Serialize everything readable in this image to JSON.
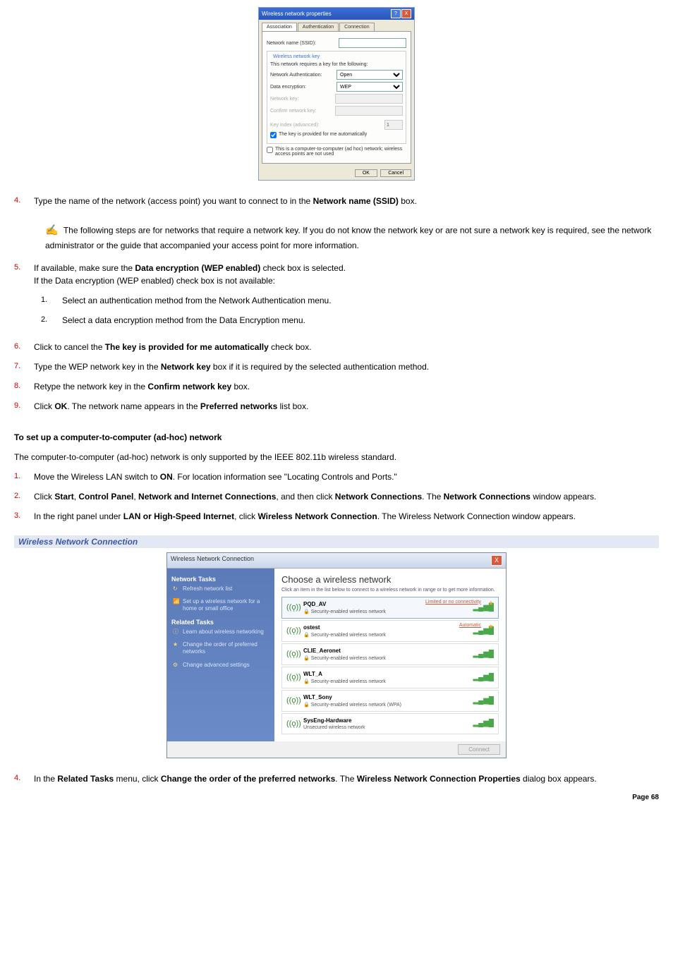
{
  "dialog1": {
    "title": "Wireless network properties",
    "tabs": [
      "Association",
      "Authentication",
      "Connection"
    ],
    "ssid_label": "Network name (SSID):",
    "fieldset_title": "Wireless network key",
    "fieldset_desc": "This network requires a key for the following:",
    "auth_label": "Network Authentication:",
    "auth_value": "Open",
    "enc_label": "Data encryption:",
    "enc_value": "WEP",
    "key_label": "Network key:",
    "confirm_label": "Confirm network key:",
    "index_label": "Key index (advanced):",
    "index_value": "1",
    "auto_key": "The key is provided for me automatically",
    "adhoc": "This is a computer-to-computer (ad hoc) network; wireless access points are not used",
    "ok": "OK",
    "cancel": "Cancel"
  },
  "steps_a": {
    "s4": {
      "n": "4.",
      "t1": "Type the name of the network (access point) you want to connect to in the ",
      "b": "Network name (SSID)",
      "t2": " box."
    },
    "note": "The following steps are for networks that require a network key. If you do not know the network key or are not sure a network key is required, see the network administrator or the guide that accompanied your access point for more information.",
    "s5": {
      "n": "5.",
      "t1": "If available, make sure the ",
      "b": "Data encryption (WEP enabled)",
      "t2": " check box is selected.",
      "t3": "If the Data encryption (WEP enabled) check box is not available:",
      "sub1": {
        "n": "1.",
        "t": "Select an authentication method from the Network Authentication menu."
      },
      "sub2": {
        "n": "2.",
        "t": "Select a data encryption method from the Data Encryption menu."
      }
    },
    "s6": {
      "n": "6.",
      "t1": "Click to cancel the ",
      "b": "The key is provided for me automatically",
      "t2": " check box."
    },
    "s7": {
      "n": "7.",
      "t1": "Type the WEP network key in the ",
      "b": "Network key",
      "t2": " box if it is required by the selected authentication method."
    },
    "s8": {
      "n": "8.",
      "t1": "Retype the network key in the ",
      "b": "Confirm network key",
      "t2": " box."
    },
    "s9": {
      "n": "9.",
      "t1": "Click ",
      "b1": "OK",
      "t2": ". The network name appears in the ",
      "b2": "Preferred networks",
      "t3": " list box."
    }
  },
  "heading2": "To set up a computer-to-computer (ad-hoc) network",
  "para2": "The computer-to-computer (ad-hoc) network is only supported by the IEEE 802.11b wireless standard.",
  "steps_b": {
    "s1": {
      "n": "1.",
      "t1": "Move the Wireless LAN switch to ",
      "b": "ON",
      "t2": ". For location information see \"Locating Controls and Ports.\""
    },
    "s2": {
      "n": "2.",
      "t1": "Click ",
      "b1": "Start",
      "t2": ", ",
      "b2": "Control Panel",
      "t3": ", ",
      "b3": "Network and Internet Connections",
      "t4": ", and then click ",
      "b4": "Network Connections",
      "t5": ". The ",
      "b5": "Network Connections",
      "t6": " window appears."
    },
    "s3": {
      "n": "3.",
      "t1": "In the right panel under ",
      "b1": "LAN or High-Speed Internet",
      "t2": ", click ",
      "b2": "Wireless Network Connection",
      "t3": ". The Wireless Network Connection window appears."
    }
  },
  "caption2": "Wireless Network Connection",
  "dialog2": {
    "title": "Wireless Network Connection",
    "side_head1": "Network Tasks",
    "side_items1": [
      "Refresh network list",
      "Set up a wireless network for a home or small office"
    ],
    "side_head2": "Related Tasks",
    "side_items2": [
      "Learn about wireless networking",
      "Change the order of preferred networks",
      "Change advanced settings"
    ],
    "main_head": "Choose a wireless network",
    "main_sub": "Click an item in the list below to connect to a wireless network in range or to get more information.",
    "networks": [
      {
        "name": "PQD_AV",
        "desc": "Security-enabled wireless network",
        "status": "Limited or no connectivity",
        "star": true,
        "secured": true
      },
      {
        "name": "ostest",
        "desc": "Security-enabled wireless network",
        "status": "Automatic",
        "star": true,
        "secured": true
      },
      {
        "name": "CLIE_Aeronet",
        "desc": "Security-enabled wireless network",
        "secured": true
      },
      {
        "name": "WLT_A",
        "desc": "Security-enabled wireless network",
        "secured": true
      },
      {
        "name": "WLT_Sony",
        "desc": "Security-enabled wireless network (WPA)",
        "secured": true
      },
      {
        "name": "SysEng-Hardware",
        "desc": "Unsecured wireless network",
        "secured": false
      }
    ],
    "connect": "Connect"
  },
  "steps_c": {
    "s4": {
      "n": "4.",
      "t1": "In the ",
      "b1": "Related Tasks",
      "t2": " menu, click ",
      "b2": "Change the order of the preferred networks",
      "t3": ". The ",
      "b3": "Wireless Network Connection Properties",
      "t4": " dialog box appears."
    }
  },
  "page": "Page 68"
}
